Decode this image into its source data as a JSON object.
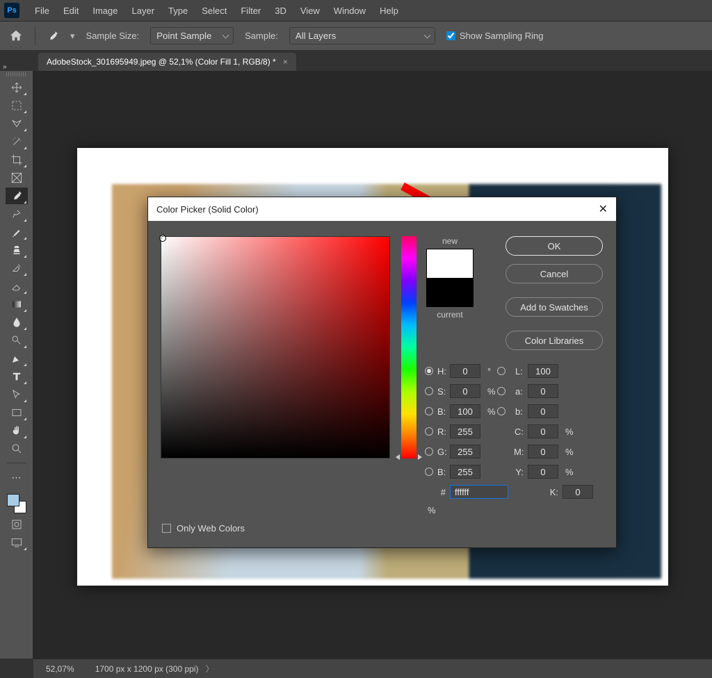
{
  "menu": {
    "file": "File",
    "edit": "Edit",
    "image": "Image",
    "layer": "Layer",
    "type": "Type",
    "select": "Select",
    "filter": "Filter",
    "threeD": "3D",
    "view": "View",
    "window": "Window",
    "help": "Help"
  },
  "options": {
    "sample_size_label": "Sample Size:",
    "sample_size_value": "Point Sample",
    "sample_label": "Sample:",
    "sample_value": "All Layers",
    "show_sampling_ring": "Show Sampling Ring"
  },
  "tab": {
    "title": "AdobeStock_301695949.jpeg @ 52,1% (Color Fill 1, RGB/8) *",
    "close": "×"
  },
  "dialog": {
    "title": "Color Picker (Solid Color)",
    "ok": "OK",
    "cancel": "Cancel",
    "add": "Add to Swatches",
    "lib": "Color Libraries",
    "new": "new",
    "current": "current",
    "only_web": "Only Web Colors",
    "deg": "°",
    "pct": "%",
    "H": "H:",
    "S": "S:",
    "Bv": "B:",
    "R": "R:",
    "G": "G:",
    "Bb": "B:",
    "L": "L:",
    "a": "a:",
    "b": "b:",
    "C": "C:",
    "M": "M:",
    "Y": "Y:",
    "K": "K:",
    "val": {
      "H": "0",
      "S": "0",
      "Bv": "100",
      "R": "255",
      "G": "255",
      "Bb": "255",
      "L": "100",
      "a": "0",
      "b": "0",
      "C": "0",
      "M": "0",
      "Y": "0",
      "K": "0"
    },
    "hash": "#",
    "hex": "ffffff"
  },
  "status": {
    "zoom": "52,07%",
    "dims": "1700 px x 1200 px (300 ppi)"
  },
  "colors": {
    "foreground": "#a7cde8",
    "background": "#ffffff"
  }
}
